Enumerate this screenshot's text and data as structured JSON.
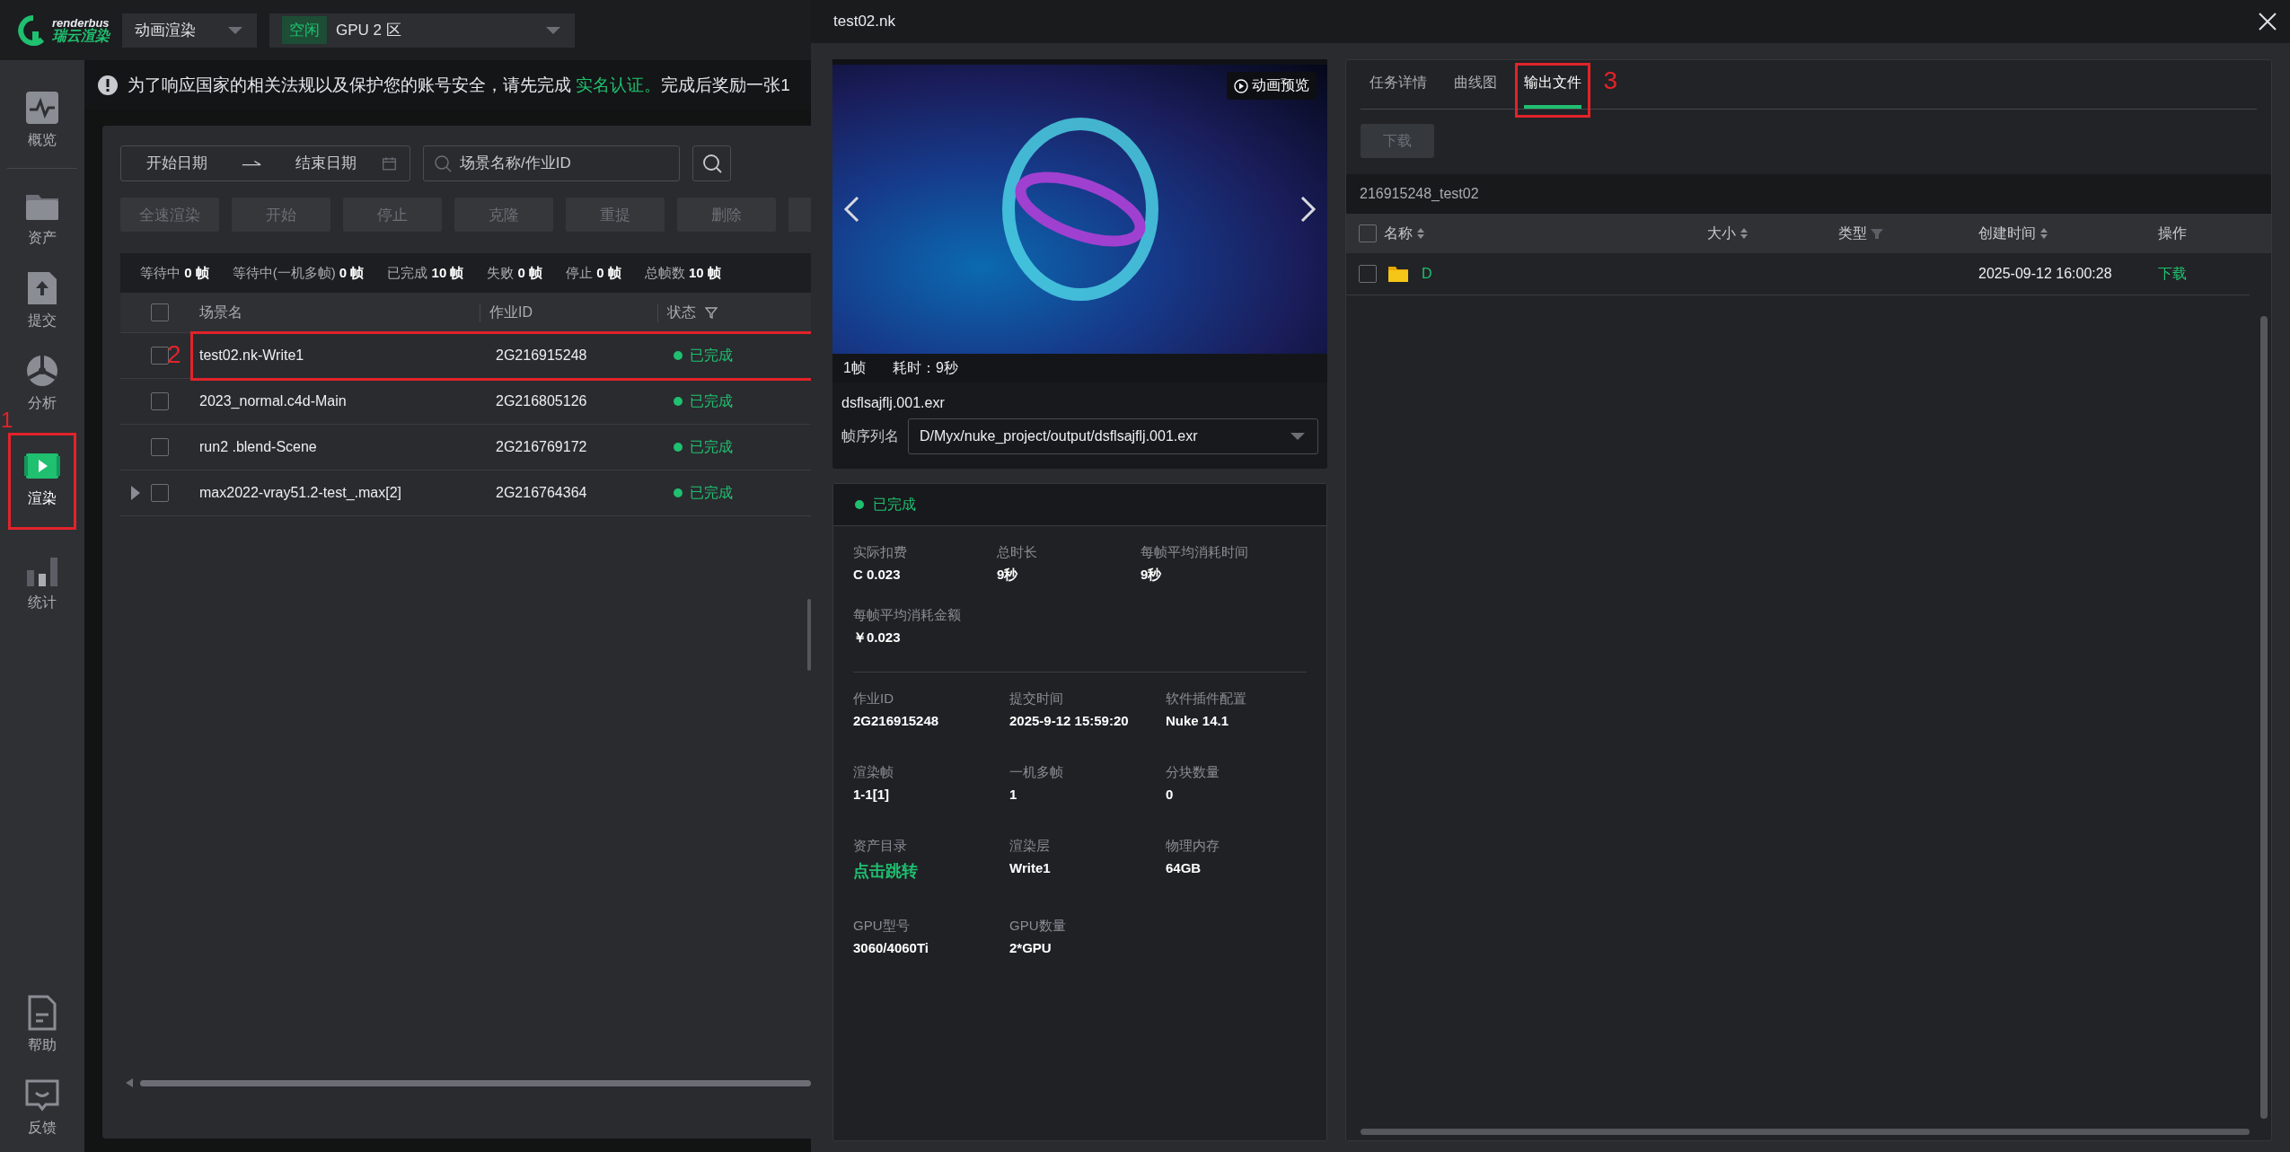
{
  "top_bar": {
    "logo": {
      "wordmark": "renderbus",
      "name": "瑞云渲染"
    },
    "mode_select": {
      "value": "动画渲染"
    },
    "zone_select": {
      "badge": "空闲",
      "value": "GPU 2 区"
    }
  },
  "sidebar": {
    "items": [
      {
        "kind": "pulse",
        "label": "概览",
        "selected": false
      },
      {
        "kind": "folder",
        "label": "资产",
        "selected": false
      },
      {
        "kind": "upload",
        "label": "提交",
        "selected": false
      },
      {
        "kind": "pie",
        "label": "分析",
        "selected": false
      },
      {
        "kind": "film",
        "label": "渲染",
        "selected": true,
        "annotation": "1"
      },
      {
        "kind": "bars",
        "label": "统计",
        "selected": false
      }
    ],
    "bottom_items": [
      {
        "kind": "doc",
        "label": "帮助",
        "selected": false
      },
      {
        "kind": "chat",
        "label": "反馈",
        "selected": false
      }
    ]
  },
  "notice": {
    "text_before": "为了响应国家的相关法规以及保护您的账号安全，请先完成 ",
    "link": "实名认证。",
    "text_after": "完成后奖励一张1"
  },
  "filters": {
    "start_date": {
      "placeholder": "开始日期"
    },
    "end_date": {
      "placeholder": "结束日期"
    },
    "search": {
      "placeholder": "场景名称/作业ID"
    }
  },
  "toolbar": [
    {
      "label": "全速渲染",
      "disabled": true
    },
    {
      "label": "开始",
      "disabled": true
    },
    {
      "label": "停止",
      "disabled": true
    },
    {
      "label": "克隆",
      "disabled": true
    },
    {
      "label": "重提",
      "disabled": true
    },
    {
      "label": "删除",
      "disabled": true
    }
  ],
  "stats": [
    {
      "label": "等待中",
      "value": "0",
      "unit": "帧"
    },
    {
      "label": "等待中(一机多帧)",
      "value": "0",
      "unit": "帧"
    },
    {
      "label": "已完成",
      "value": "10",
      "unit": "帧"
    },
    {
      "label": "失败",
      "value": "0",
      "unit": "帧"
    },
    {
      "label": "停止",
      "value": "0",
      "unit": "帧"
    },
    {
      "label": "总帧数",
      "value": "10",
      "unit": "帧"
    }
  ],
  "job_table": {
    "all_checked": false,
    "columns": [
      {
        "label": "场景名",
        "filter": false
      },
      {
        "label": "作业ID",
        "filter": false
      },
      {
        "label": "状态",
        "filter": true
      }
    ],
    "rows": [
      {
        "name": "test02.nk-Write1",
        "job_id": "2G216915248",
        "status": "已完成",
        "checked": false,
        "expandable": false,
        "annotation": "2"
      },
      {
        "name": "2023_normal.c4d-Main",
        "job_id": "2G216805126",
        "status": "已完成",
        "checked": false,
        "expandable": false
      },
      {
        "name": "run2 .blend-Scene",
        "job_id": "2G216769172",
        "status": "已完成",
        "checked": false,
        "expandable": false
      },
      {
        "name": "max2022-vray51.2-test_.max[2]",
        "job_id": "2G216764364",
        "status": "已完成",
        "checked": false,
        "expandable": true
      }
    ]
  },
  "drawer": {
    "title": "test02.nk",
    "preview": {
      "badge": "动画预览",
      "frames": "1帧",
      "time": "耗时：9秒",
      "file": "dsflsajflj.001.exr",
      "sequence_label": "帧序列名",
      "sequence_value": "D/Myx/nuke_project/output/dsflsajflj.001.exr"
    },
    "status": {
      "label": "已完成"
    },
    "summary": [
      {
        "label": "实际扣费",
        "value": "C 0.023"
      },
      {
        "label": "总时长",
        "value": "9秒"
      },
      {
        "label": "每帧平均消耗时间",
        "value": "9秒"
      },
      {
        "label": "每帧平均消耗金额",
        "value": "￥0.023"
      }
    ],
    "details": [
      {
        "label": "作业ID",
        "value": "2G216915248",
        "kind": "text"
      },
      {
        "label": "提交时间",
        "value": "2025-9-12 15:59:20",
        "kind": "text"
      },
      {
        "label": "软件插件配置",
        "value": "Nuke 14.1",
        "kind": "text"
      },
      {
        "label": "渲染帧",
        "value": "1-1[1]",
        "kind": "text"
      },
      {
        "label": "一机多帧",
        "value": "1",
        "kind": "text"
      },
      {
        "label": "分块数量",
        "value": "0",
        "kind": "text"
      },
      {
        "label": "资产目录",
        "value": "点击跳转",
        "kind": "link"
      },
      {
        "label": "渲染层",
        "value": "Write1",
        "kind": "text"
      },
      {
        "label": "物理内存",
        "value": "64GB",
        "kind": "text"
      },
      {
        "label": "GPU型号",
        "value": "3060/4060Ti",
        "kind": "text"
      },
      {
        "label": "GPU数量",
        "value": "2*GPU",
        "kind": "text"
      }
    ],
    "tabs": [
      {
        "label": "任务详情",
        "selected": false
      },
      {
        "label": "曲线图",
        "selected": false
      },
      {
        "label": "输出文件",
        "selected": true,
        "annotation": "3"
      }
    ],
    "download_button": {
      "label": "下载",
      "disabled": true
    },
    "path": "216915248_test02",
    "file_table": {
      "all_checked": false,
      "columns": [
        {
          "label": "名称",
          "sortable": true,
          "filterable": false
        },
        {
          "label": "大小",
          "sortable": true,
          "filterable": false
        },
        {
          "label": "类型",
          "sortable": false,
          "filterable": true
        },
        {
          "label": "创建时间",
          "sortable": true,
          "filterable": false
        },
        {
          "label": "操作",
          "sortable": false,
          "filterable": false
        }
      ],
      "rows": [
        {
          "kind": "folder",
          "name": "D",
          "created": "2025-09-12 16:00:28",
          "action": "下载",
          "checked": false
        }
      ]
    }
  }
}
